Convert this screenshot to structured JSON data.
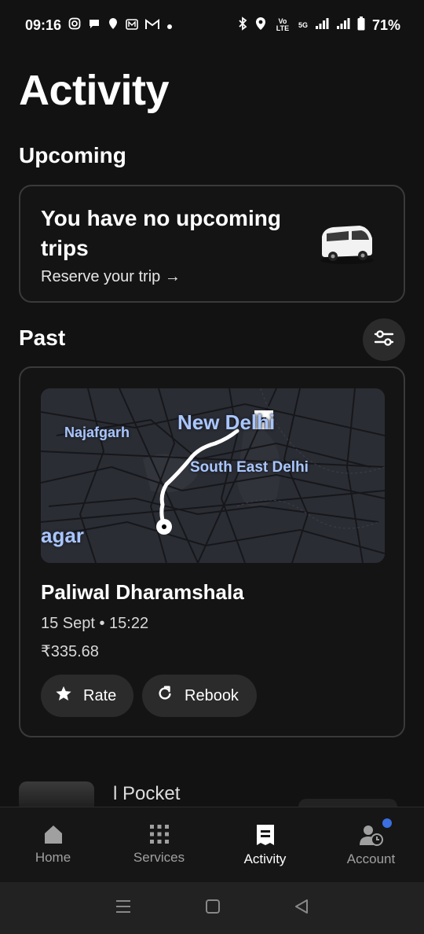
{
  "status_bar": {
    "time": "09:16",
    "left_icons": [
      "instagram-icon",
      "chat-bubble-icon",
      "location-pin-icon",
      "m-app-icon",
      "gmail-icon",
      "dot-icon"
    ],
    "network_a": "Vo LTE",
    "network_b": "5G",
    "battery": "71%"
  },
  "page_title": "Activity",
  "upcoming": {
    "heading": "Upcoming",
    "card_title": "You have no upcoming trips",
    "link": "Reserve your trip →"
  },
  "past": {
    "heading": "Past",
    "filter_icon": "sliders-icon",
    "trip": {
      "map_labels": {
        "najafgarh": "Najafgarh",
        "new_delhi": "New Delhi",
        "south_east_delhi": "South East Delhi",
        "nagar": "agar"
      },
      "title": "Paliwal Dharamshala",
      "date": "15 Sept • 15:22",
      "price": "₹335.68",
      "rate_label": "Rate",
      "rebook_label": "Rebook"
    },
    "next_trip_title": "l Pocket"
  },
  "bottom_nav": {
    "home": "Home",
    "services": "Services",
    "activity": "Activity",
    "account": "Account",
    "active": "activity"
  },
  "colors": {
    "background": "#121212",
    "card_border": "#3a3a3a",
    "pill_bg": "#2b2b2b",
    "map_label": "#a9c6ff",
    "badge": "#3b6fe0"
  }
}
